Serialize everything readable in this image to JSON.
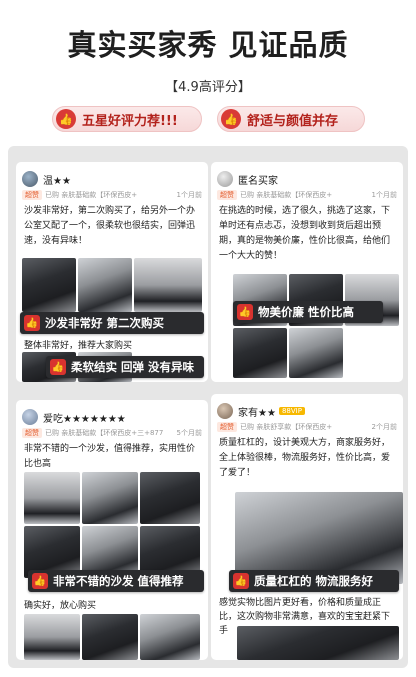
{
  "header": {
    "title": "真实买家秀 见证品质",
    "subtitle": "【4.9高评分】"
  },
  "pills": [
    {
      "text": "五星好评力荐!!!",
      "icon": "thumbs-up-icon"
    },
    {
      "text": "舒适与颜值并存",
      "icon": "thumbs-up-icon"
    }
  ],
  "colors": {
    "accent": "#d8332f",
    "banner": "#2a2b2e",
    "panel": "#e6e6e6"
  },
  "reviews": [
    {
      "user": "温★★",
      "badge": "超赞",
      "purchase": "已购 亲肤基础款【环保西皮+",
      "time": "1个月前",
      "text": "沙发非常好，第二次购买了，给另外一个办公室又配了一个，很柔软也很结实，回弹迅速，没有异味！",
      "banners": [
        "沙发非常好 第二次购买",
        "柔软结实 回弹 没有异味"
      ],
      "footer": "整体非常好，推荐大家购买"
    },
    {
      "user": "匿名买家",
      "badge": "超赞",
      "purchase": "已购 亲肤基础款【环保西皮+",
      "time": "1个月前",
      "text": "在挑选的时候，选了很久，挑选了这家，下单时还有点忐忑，没想到收到货后超出预期，真的是物美价廉，性价比很高，给他们一个大大的赞！",
      "banners": [
        "物美价廉 性价比高"
      ]
    },
    {
      "user": "爱吃★★★★★★★",
      "badge": "超赞",
      "purchase": "已购 亲肤基础款【环保西皮+三+877",
      "time": "5个月前",
      "text": "非常不错的一个沙发，值得推荐，实用性价比也高",
      "banners": [
        "非常不错的沙发 值得推荐"
      ],
      "footer": "确实好，放心购买"
    },
    {
      "user": "家有★★",
      "badge": "超赞",
      "vip": "88VIP",
      "purchase": "已购 亲肤舒享款【环保西皮+",
      "time": "2个月前",
      "text": "质量杠杠的，设计美观大方，商家服务好，全上体验很棒，物流服务好，性价比高，爱了爱了！",
      "banners": [
        "质量杠杠的 物流服务好"
      ],
      "footer": "感觉实物比图片更好看，价格和质量成正比，这次购物非常满意，喜欢的宝宝赶紧下手"
    }
  ]
}
